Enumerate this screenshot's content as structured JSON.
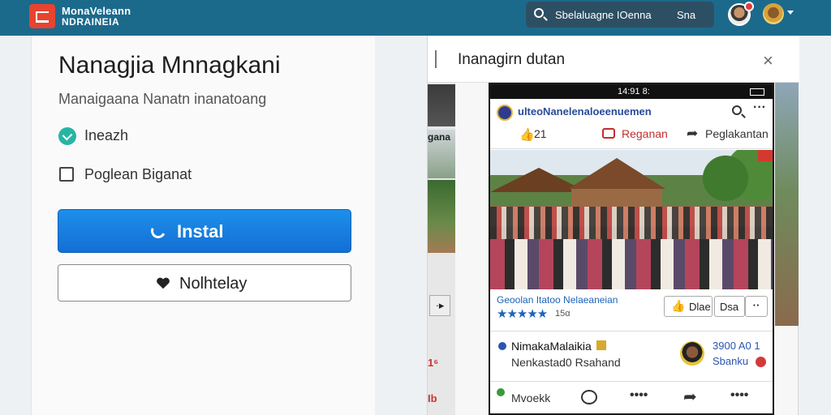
{
  "topbar": {
    "brand_line1": "MonaVeleann",
    "brand_line2": "NDRAINEIA",
    "search_text": "Sbelaluagne IOenna",
    "search_button": "Sna"
  },
  "left_panel": {
    "title": "Nanagjia Mnnagkani",
    "subtitle": "Manaigaana Nanatn inanatoang",
    "radio_label": "Ineazh",
    "checkbox_label": "Poglean Biganat",
    "install_button": "Instal",
    "other_button": "Nolhtelay"
  },
  "right_panel": {
    "title": "Inanagirn dutan",
    "close": "×",
    "side_text": "gana",
    "side_button": "·▸",
    "side_badge1": "1⁶",
    "side_badge2": "Ib",
    "phone": {
      "status_time": "14:91 8:",
      "page_name": "ulteoNanelenaloeenuemen",
      "actions": {
        "like": "21",
        "comment": "Reganan",
        "share": "Peglakantan"
      },
      "rating_text": "Geoolan Itatoo Nelaeaneian",
      "stars": "★★★★★",
      "stars_count": "15α",
      "btn_one": "Dlae",
      "btn_two": "Dsa",
      "btn_three": "··",
      "comment": {
        "name": "NimakaMalaikia",
        "text": "Nenkastad0 Rsahand",
        "meta1": "3900 A0 1",
        "meta2": "Sbanku"
      },
      "bottom_label": "Mvoekk",
      "bottom_dots1": "••••",
      "bottom_dots2": "••••"
    }
  },
  "colors": {
    "topbar": "#1b6a8c",
    "install": "#1d8fea",
    "accent_teal": "#27b5a3"
  }
}
